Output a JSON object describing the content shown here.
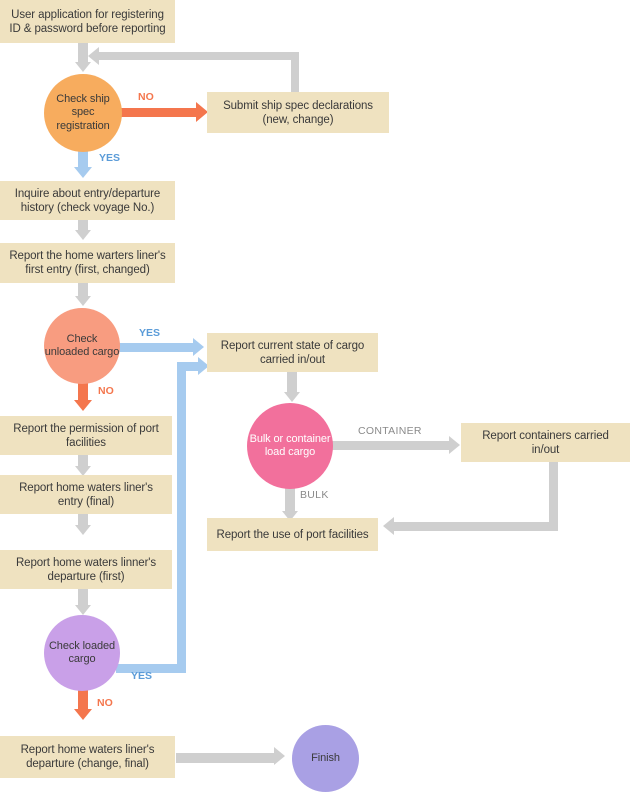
{
  "diagram": {
    "title": "Ship entry/departure reporting flowchart",
    "colors": {
      "box_fill": "#EFE2C0",
      "orange_circle": "#F7AC5E",
      "salmon_circle": "#F89C80",
      "pink_circle": "#F2709C",
      "violet_circle": "#C9A0E8",
      "indigo_circle": "#A9A0E4",
      "gray_connector": "#CFCFCF",
      "blue_connector": "#A6CBEF",
      "orange_connector": "#F4764D",
      "yes_label": "#5A9BD8",
      "no_label": "#F4764D"
    }
  },
  "nodes": {
    "user_application": "User application for registering ID & password before reporting",
    "check_ship_spec": "Check ship spec registration",
    "submit_ship_spec": "Submit ship spec declarations (new, change)",
    "inquire_history": "Inquire about entry/departure history (check voyage No.)",
    "report_first_entry": "Report the home warters liner's first entry (first, changed)",
    "check_unloaded_cargo": "Check unloaded cargo",
    "report_current_cargo": "Report current state of cargo carried in/out",
    "bulk_or_container": "Bulk or container load cargo",
    "report_containers": "Report containers carried in/out",
    "report_permission": "Report the permission of port facilities",
    "report_entry_final": "Report home waters liner's entry (final)",
    "report_departure_first": "Report home waters linner's departure (first)",
    "report_use_port": "Report the use of port facilities",
    "check_loaded_cargo": "Check loaded cargo",
    "report_departure_final": "Report home waters liner's departure (change, final)",
    "finish": "Finish"
  },
  "edge_labels": {
    "ship_spec_no": "NO",
    "ship_spec_yes": "YES",
    "unloaded_yes": "YES",
    "unloaded_no": "NO",
    "container": "CONTAINER",
    "bulk": "BULK",
    "loaded_yes": "YES",
    "loaded_no": "NO"
  }
}
